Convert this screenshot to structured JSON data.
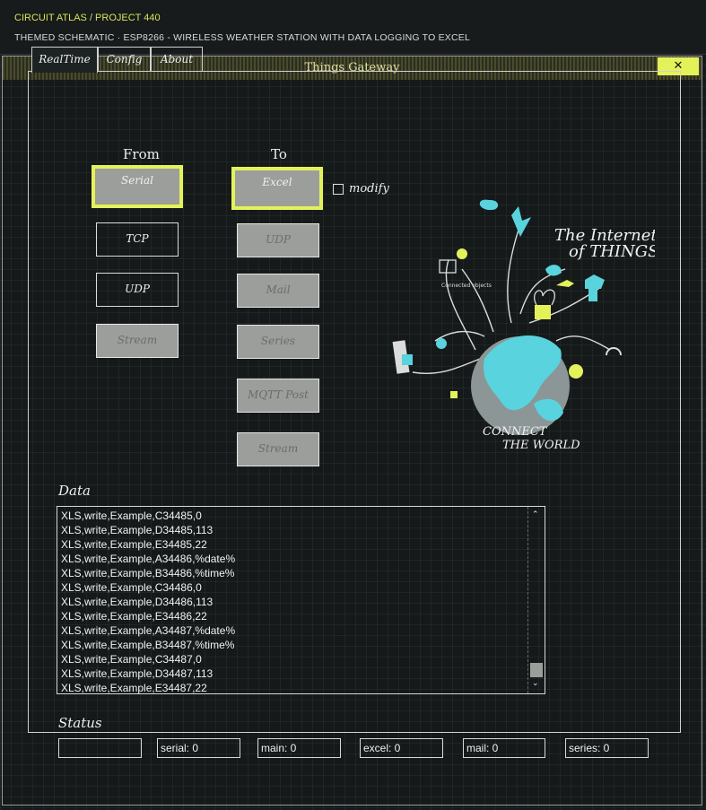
{
  "header": {
    "breadcrumb": "CIRCUIT ATLAS / PROJECT 440",
    "subtitle": "THEMED SCHEMATIC · ESP8266 - WIRELESS WEATHER STATION WITH DATA LOGGING TO EXCEL"
  },
  "window": {
    "title": "Things Gateway",
    "close_label": "✕"
  },
  "tabs": [
    {
      "label": "RealTime"
    },
    {
      "label": "Config"
    },
    {
      "label": "About"
    }
  ],
  "from": {
    "heading": "From",
    "buttons": [
      "Serial",
      "TCP",
      "UDP",
      "Stream"
    ]
  },
  "to": {
    "heading": "To",
    "buttons": [
      "Excel",
      "UDP",
      "Mail",
      "Series",
      "MQTT Post",
      "Stream"
    ],
    "modify_label": "modify",
    "modify_checked": false
  },
  "illustration": {
    "heading_line1": "The Internet",
    "heading_line2": "of THINGS",
    "footer_line1": "CONNECT",
    "footer_line2": "THE WORLD",
    "caption": "Connected objects"
  },
  "data": {
    "label": "Data",
    "lines": [
      "XLS,write,Example,C34485,0",
      "XLS,write,Example,D34485,113",
      "XLS,write,Example,E34485,22",
      "XLS,write,Example,A34486,%date%",
      "XLS,write,Example,B34486,%time%",
      "XLS,write,Example,C34486,0",
      "XLS,write,Example,D34486,113",
      "XLS,write,Example,E34486,22",
      "XLS,write,Example,A34487,%date%",
      "XLS,write,Example,B34487,%time%",
      "XLS,write,Example,C34487,0",
      "XLS,write,Example,D34487,113",
      "XLS,write,Example,E34487,22"
    ]
  },
  "status": {
    "label": "Status",
    "fields": [
      "",
      "serial: 0",
      "main: 0",
      "excel: 0",
      "mail: 0",
      "series: 0"
    ]
  },
  "colors": {
    "accent": "#e4f25a",
    "globe_water": "#59d3dd",
    "globe_land": "#8c9696",
    "background": "#15191a"
  }
}
